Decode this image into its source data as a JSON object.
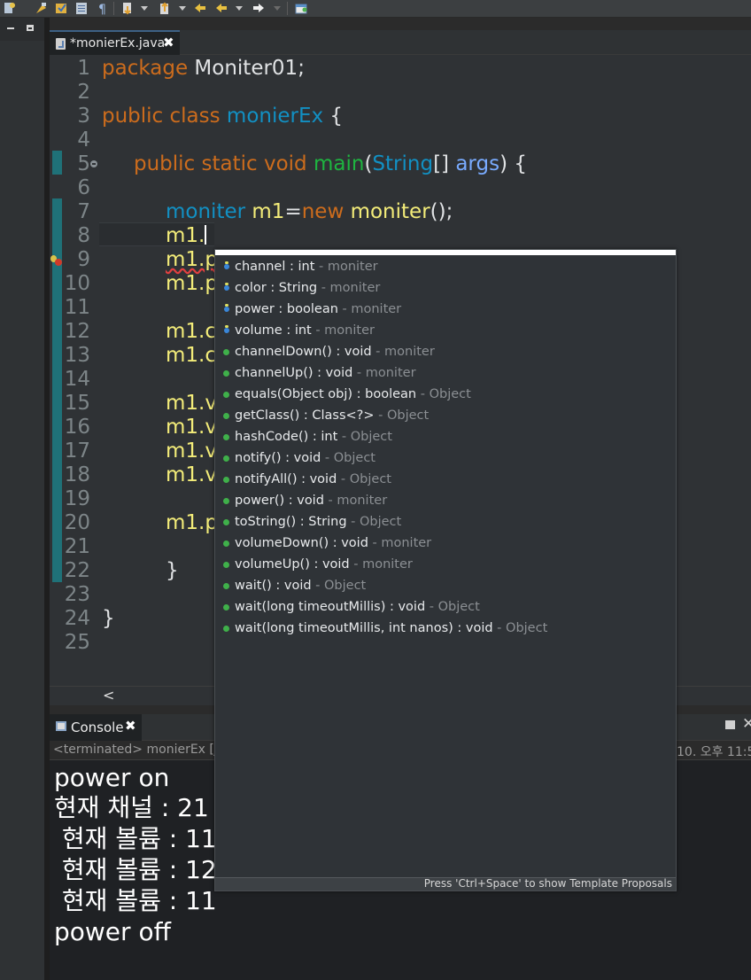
{
  "toolbar": {
    "buttons": [
      "new-icon",
      "open-type-icon",
      "task-icon",
      "show-whitespace-icon",
      "pilcrow-icon",
      "next-annotation-icon",
      "prev-annotation-icon",
      "last-edit-icon",
      "back-icon",
      "forward-icon",
      "new-window-icon"
    ]
  },
  "editor_tab": {
    "title": "*monierEx.java",
    "close": "✖"
  },
  "editor": {
    "line_numbers": [
      "1",
      "2",
      "3",
      "4",
      "5",
      "6",
      "7",
      "8",
      "9",
      "10",
      "11",
      "12",
      "13",
      "14",
      "15",
      "16",
      "17",
      "18",
      "19",
      "20",
      "21",
      "22",
      "23",
      "24",
      "25"
    ],
    "lines": {
      "l1": {
        "kw": "package",
        "rest": " Moniter01;"
      },
      "l3": {
        "kw": "public class",
        "name": "monierEx",
        "rest": " {"
      },
      "l5": {
        "kw": "public static void",
        "fn": "main",
        "p1": "(",
        "ty": "String",
        "p2": "[] ",
        "param": "args",
        "p3": ") {"
      },
      "l7": {
        "ty": "moniter",
        "var": "m1",
        "eq": "=",
        "kw": "new",
        "ctor": "moniter",
        "rest": "();"
      },
      "l8": "m1.",
      "l9": "m1.p",
      "l10": "m1.p",
      "l12": "m1.c",
      "l13": "m1.c",
      "l15": "m1.v",
      "l16": "m1.v",
      "l17": "m1.v",
      "l18": "m1.v",
      "l20": "m1.p",
      "l22": "}",
      "l24": "}"
    },
    "scroll_left": "<"
  },
  "content_assist": {
    "items": [
      {
        "kind": "field",
        "sig": "channel : int",
        "owner": " - moniter"
      },
      {
        "kind": "field",
        "sig": "color : String",
        "owner": " - moniter"
      },
      {
        "kind": "field",
        "sig": "power : boolean",
        "owner": " - moniter"
      },
      {
        "kind": "field",
        "sig": "volume : int",
        "owner": " - moniter"
      },
      {
        "kind": "method",
        "sig": "channelDown() : void",
        "owner": " - moniter"
      },
      {
        "kind": "method",
        "sig": "channelUp() : void",
        "owner": " - moniter"
      },
      {
        "kind": "method",
        "sig": "equals(Object obj) : boolean",
        "owner": " - Object"
      },
      {
        "kind": "method",
        "sig": "getClass() : Class<?>",
        "owner": " - Object"
      },
      {
        "kind": "method",
        "sig": "hashCode() : int",
        "owner": " - Object"
      },
      {
        "kind": "method",
        "sig": "notify() : void",
        "owner": " - Object"
      },
      {
        "kind": "method",
        "sig": "notifyAll() : void",
        "owner": " - Object"
      },
      {
        "kind": "method",
        "sig": "power() : void",
        "owner": " - moniter"
      },
      {
        "kind": "method",
        "sig": "toString() : String",
        "owner": " - Object"
      },
      {
        "kind": "method",
        "sig": "volumeDown() : void",
        "owner": " - moniter"
      },
      {
        "kind": "method",
        "sig": "volumeUp() : void",
        "owner": " - moniter"
      },
      {
        "kind": "method",
        "sig": "wait() : void",
        "owner": " - Object"
      },
      {
        "kind": "method",
        "sig": "wait(long timeoutMillis) : void",
        "owner": " - Object"
      },
      {
        "kind": "method",
        "sig": "wait(long timeoutMillis, int nanos) : void",
        "owner": " - Object"
      }
    ],
    "footer": "Press 'Ctrl+Space' to show Template Proposals"
  },
  "console": {
    "tab_label": "Console",
    "close": "✖",
    "status_left": "<terminated> monierEx [Ja",
    "status_right": "10. 오후 11:5",
    "output": [
      "power on",
      "현재 채널 : 21",
      " 현재 볼륨 : 11",
      " 현재 볼륨 : 12",
      " 현재 볼륨 : 11",
      "power off"
    ]
  },
  "colors": {
    "keyword": "#cc6c1d",
    "method_decl": "#1eb540",
    "type": "#1290c3",
    "local_var": "#f3ec79",
    "console_bg": "#1f2124",
    "editor_bg": "#2f3235"
  }
}
